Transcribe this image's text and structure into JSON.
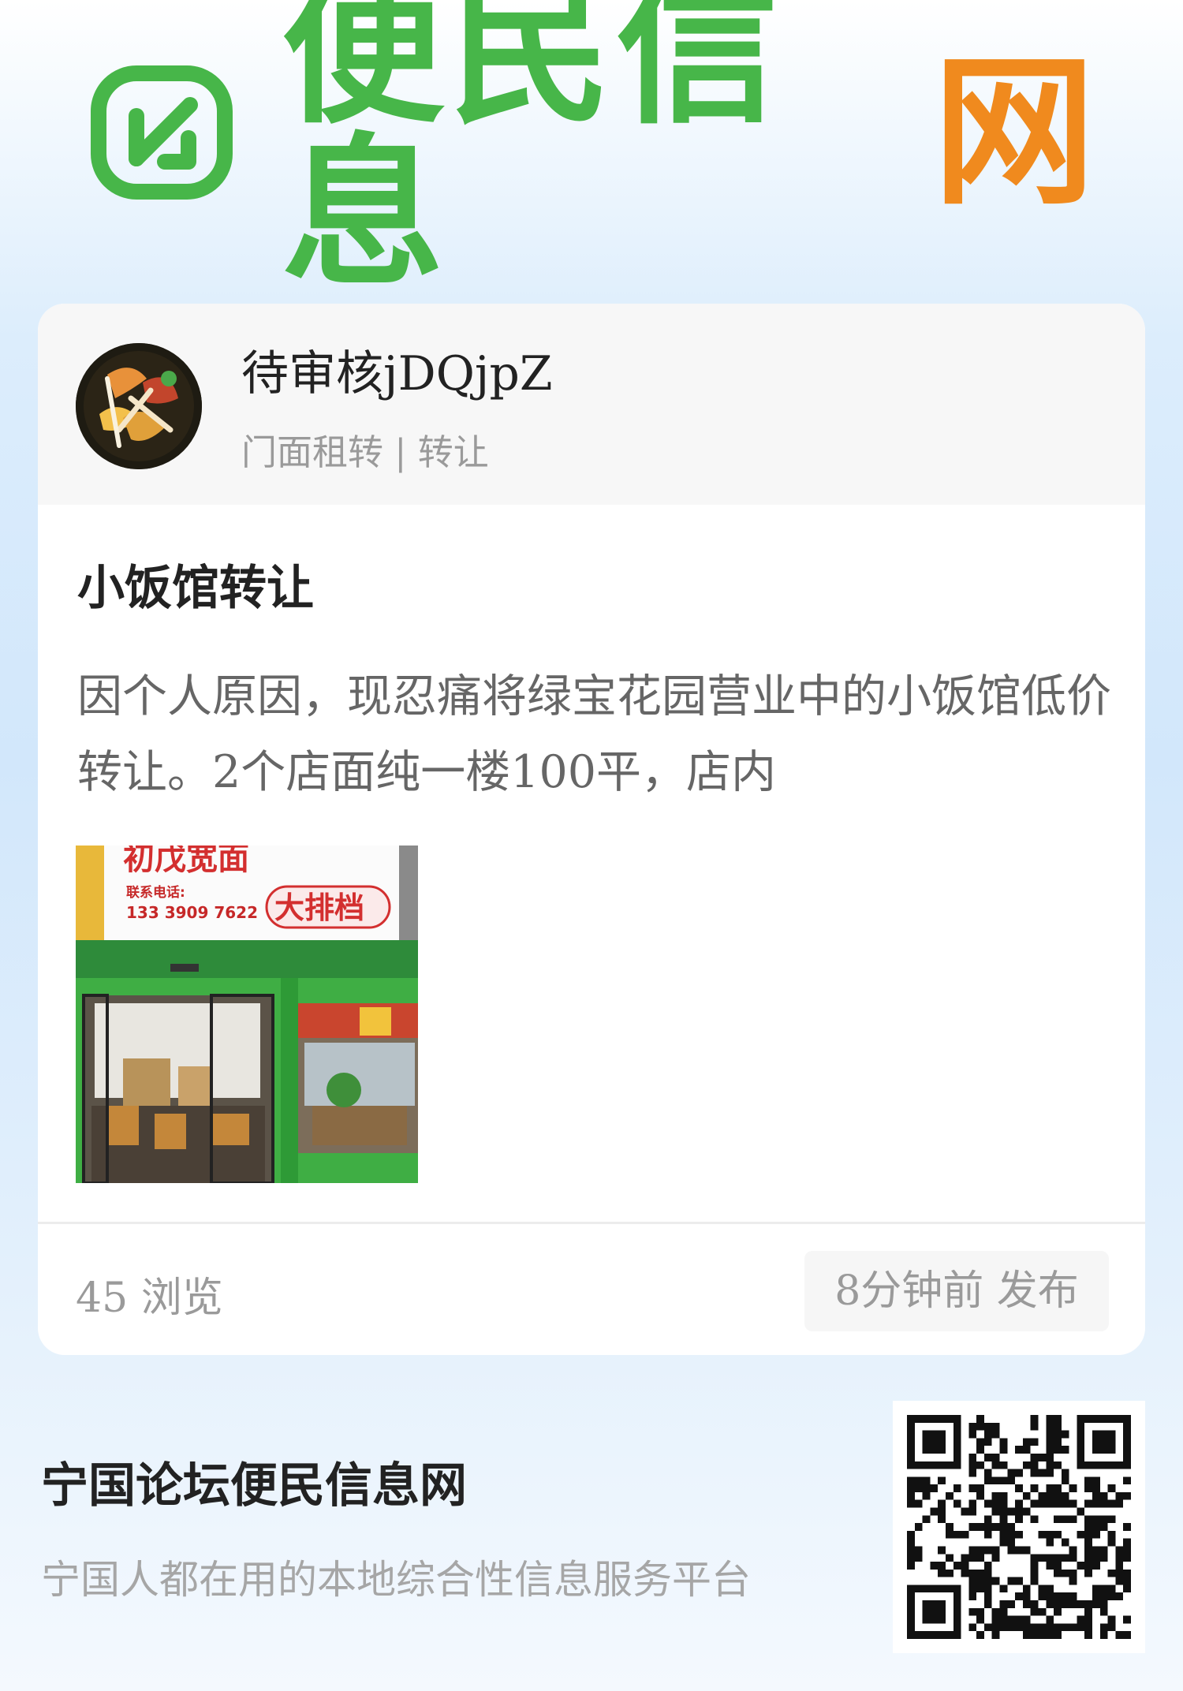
{
  "brand": {
    "title_green": "便民信息",
    "title_orange": "网",
    "green": "#47b649",
    "orange": "#f08a1e"
  },
  "post": {
    "username": "待审核jDQjpZ",
    "category": "门面租转 | 转让",
    "title": "小饭馆转让",
    "body": "因个人原因，现忍痛将绿宝花园营业中的小饭馆低价转让。2个店面纯一楼100平，店内",
    "photo": {
      "sign_text": "初戊宽面",
      "contact_label": "联系电话:",
      "contact_number": "133 3909 7622",
      "badge": "大排档"
    },
    "views": "45 浏览",
    "published": "8分钟前 发布"
  },
  "footer": {
    "title": "宁国论坛便民信息网",
    "subtitle": "宁国人都在用的本地综合性信息服务平台"
  }
}
